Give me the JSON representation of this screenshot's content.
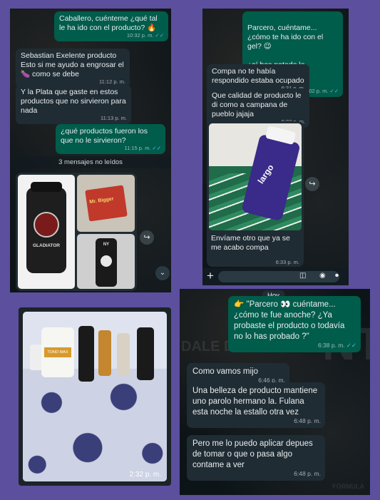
{
  "background_color": "#5b4f9e",
  "colors": {
    "incoming": "#202c33",
    "outgoing": "#005c4b",
    "read_ticks": "#53bdeb"
  },
  "panel1": {
    "messages": [
      {
        "dir": "out",
        "text": "Caballero, cuénteme ¿qué tal le ha ido con el producto? 🔥",
        "time": "10:32 p. m.",
        "ticks": "✓✓"
      },
      {
        "dir": "in",
        "text": "Sebastian Exelente producto Esto si me ayudo a engrosar el 🍆 como se debe",
        "time": "11:12 p. m."
      },
      {
        "dir": "in",
        "text": "Y la Plata que gaste en  estos productos que no sirvieron para nada",
        "time": "11:13 p. m."
      },
      {
        "dir": "out",
        "text": "¿qué productos fueron los que no le sirvieron?",
        "time": "11:15 p. m.",
        "ticks": "✓✓"
      }
    ],
    "unread_label": "3 mensajes no leídos",
    "photo_labels": {
      "jar": "GLADIATOR",
      "box": "Mr. Bigger",
      "bottle": "NY"
    }
  },
  "panel2": {
    "messages": [
      {
        "dir": "out",
        "text": "Parcero, cuéntame... ¿cómo te ha ido con el gel? 😉\n\n¿sí has notado la diferencia?",
        "time": "4:02 p. m.",
        "ticks": "✓✓"
      },
      {
        "dir": "in",
        "text": "Compa no te había respondido estaba ocupado",
        "time": "6:31 p. m."
      },
      {
        "dir": "in",
        "text": "Que calidad de producto  le di como a campana de pueblo jajaja",
        "time": "6:32 p. m."
      },
      {
        "dir": "in",
        "text": "Envíame otro que ya  se me acabo compa",
        "time": "6:33 p. m."
      }
    ],
    "photo_label": "largo"
  },
  "panel3": {
    "time": "2:32 p. m.",
    "jar_label": "TONO MAX"
  },
  "panel4": {
    "watermarks": {
      "left": "DALE D",
      "right": "NT",
      "bottom": "FÓRMULA"
    },
    "date_chip": "Hoy",
    "messages": [
      {
        "dir": "out",
        "text": "👉 \"Parcero 👀 cuéntame... ¿cómo te fue anoche? ¿Ya probaste el producto o  todavía no lo has probado ?\"",
        "time": "6:38 p. m.",
        "ticks": "✓✓"
      },
      {
        "dir": "in",
        "text": "Como vamos mijo",
        "time": "6:46 p. m."
      },
      {
        "dir": "in",
        "text": "Una belleza de producto mantiene uno parolo hermano la. Fulana  esta noche la estallo otra vez",
        "time": "6:48 p. m."
      },
      {
        "dir": "in",
        "text": "Pero me lo puedo aplicar depues de tomar  o que  o pasa algo contame a ver",
        "time": "6:48 p. m."
      }
    ]
  }
}
